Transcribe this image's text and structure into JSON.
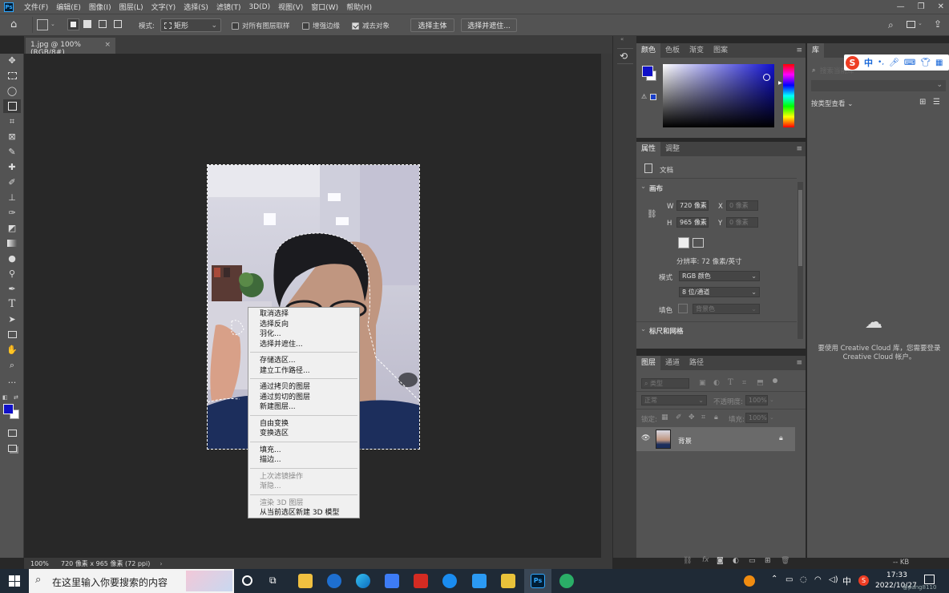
{
  "menubar": {
    "items": [
      "文件(F)",
      "编辑(E)",
      "图像(I)",
      "图层(L)",
      "文字(Y)",
      "选择(S)",
      "滤镜(T)",
      "3D(D)",
      "视图(V)",
      "窗口(W)",
      "帮助(H)"
    ]
  },
  "options": {
    "mode_label": "模式:",
    "mode_value": "矩形",
    "sample_all_label": "对所有图层取样",
    "enhance_edge_label": "增强边缘",
    "subtract_label": "减去对象",
    "select_subject": "选择主体",
    "select_mask": "选择并遮住..."
  },
  "document": {
    "tab_title": "1.jpg @ 100%(RGB/8#)",
    "close": "×"
  },
  "status": {
    "zoom": "100%",
    "info": "720 像素 x 965 像素 (72 ppi)"
  },
  "context_menu": {
    "groups": [
      [
        {
          "label": "取消选择",
          "enabled": true
        },
        {
          "label": "选择反向",
          "enabled": true
        },
        {
          "label": "羽化...",
          "enabled": true
        },
        {
          "label": "选择并遮住...",
          "enabled": true
        }
      ],
      [
        {
          "label": "存储选区...",
          "enabled": true
        },
        {
          "label": "建立工作路径...",
          "enabled": true
        }
      ],
      [
        {
          "label": "通过拷贝的图层",
          "enabled": true
        },
        {
          "label": "通过剪切的图层",
          "enabled": true
        },
        {
          "label": "新建图层...",
          "enabled": true
        }
      ],
      [
        {
          "label": "自由变换",
          "enabled": true
        },
        {
          "label": "变换选区",
          "enabled": true
        }
      ],
      [
        {
          "label": "填充...",
          "enabled": true
        },
        {
          "label": "描边...",
          "enabled": true
        }
      ],
      [
        {
          "label": "上次滤镜操作",
          "enabled": false
        },
        {
          "label": "渐隐...",
          "enabled": false
        }
      ],
      [
        {
          "label": "渲染 3D 图层",
          "enabled": false
        },
        {
          "label": "从当前选区新建 3D 模型",
          "enabled": true
        }
      ]
    ]
  },
  "color_panel": {
    "tabs": [
      "颜色",
      "色板",
      "渐变",
      "图案"
    ],
    "foreground": "#1010c8",
    "background": "#ffffff"
  },
  "properties_panel": {
    "tabs": [
      "属性",
      "调整"
    ],
    "doc_label": "文档",
    "canvas_section": "画布",
    "w_label": "W",
    "w_value": "720 像素",
    "h_label": "H",
    "h_value": "965 像素",
    "x_label": "X",
    "x_placeholder": "0 像素",
    "y_label": "Y",
    "y_placeholder": "0 像素",
    "resolution": "分辨率: 72 像素/英寸",
    "mode_label": "模式",
    "mode_value": "RGB 颜色",
    "depth_value": "8 位/通道",
    "fill_label": "填色",
    "fill_value": "背景色",
    "rulers_section": "标尺和网格"
  },
  "layers_panel": {
    "tabs": [
      "图层",
      "通道",
      "路径"
    ],
    "kind_placeholder": "类型",
    "blend_mode": "正常",
    "opacity_label": "不透明度:",
    "opacity_value": "100%",
    "lock_label": "锁定:",
    "fill_label": "填充:",
    "fill_value": "100%",
    "layer_name": "背景"
  },
  "library_panel": {
    "tab": "库",
    "search_placeholder": "搜索当前库",
    "view_by": "按类型查看",
    "message": "要使用 Creative Cloud 库，您需要登录 Creative Cloud 帐户。",
    "kb": "-- KB"
  },
  "ime_toolbar": {
    "logo": "S",
    "lang": "中"
  },
  "taskbar": {
    "search_placeholder": "在这里输入你要搜索的内容",
    "time": "17:33",
    "date": "2022/10/27",
    "ime": "中",
    "watermark": "@pang8110"
  }
}
